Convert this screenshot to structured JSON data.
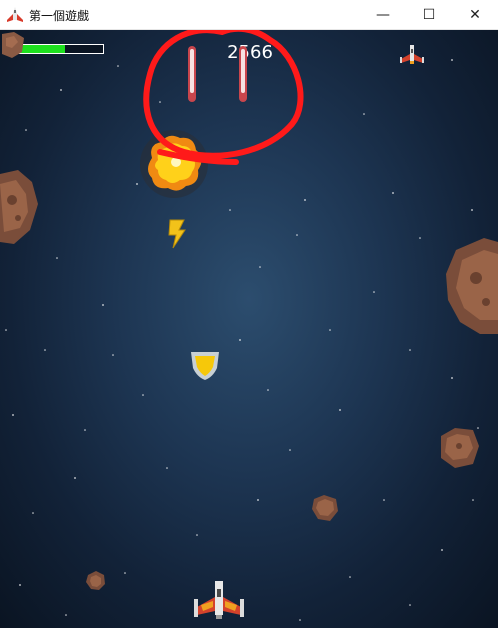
{
  "window": {
    "title": "第一個遊戲",
    "controls": {
      "minimize": "—",
      "maximize": "☐",
      "close": "✕"
    }
  },
  "hud": {
    "score": "2566",
    "health_fraction": 0.61,
    "lives": 1
  },
  "colors": {
    "health": "#1ee01e",
    "annotation": "#ff1a1a",
    "background": "#17304b"
  },
  "sprites": [
    "player-ship",
    "life-ship-icon",
    "laser-bullet",
    "laser-bullet",
    "explosion",
    "lightning-powerup",
    "shield-powerup",
    "meteor-large",
    "meteor-large",
    "meteor-medium",
    "meteor-small",
    "meteor-tiny",
    "meteor-small-top"
  ]
}
